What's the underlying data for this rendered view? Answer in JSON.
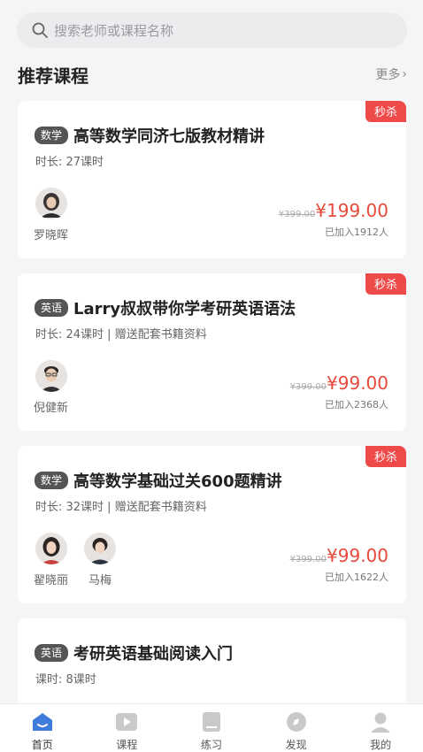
{
  "search": {
    "placeholder": "搜索老师或课程名称"
  },
  "section": {
    "title": "推荐课程",
    "more": "更多"
  },
  "courses": [
    {
      "flash": "秒杀",
      "subject": "数学",
      "title": "高等数学同济七版教材精讲",
      "meta": "时长:  27课时",
      "teachers": [
        "罗晓晖"
      ],
      "original_price": "¥399.00",
      "price": "¥199.00",
      "enrolled": "已加入1912人"
    },
    {
      "flash": "秒杀",
      "subject": "英语",
      "title": "Larry叔叔带你学考研英语语法",
      "meta": "时长:  24课时 | 赠送配套书籍资料",
      "teachers": [
        "倪健新"
      ],
      "original_price": "¥399.00",
      "price": "¥99.00",
      "enrolled": "已加入2368人"
    },
    {
      "flash": "秒杀",
      "subject": "数学",
      "title": "高等数学基础过关600题精讲",
      "meta": "时长:  32课时 | 赠送配套书籍资料",
      "teachers": [
        "翟晓丽",
        "马梅"
      ],
      "original_price": "¥399.00",
      "price": "¥99.00",
      "enrolled": "已加入1622人"
    },
    {
      "subject": "英语",
      "title": "考研英语基础阅读入门",
      "meta": "课时:  8课时"
    }
  ],
  "tabs": [
    {
      "label": "首页",
      "icon": "home-icon",
      "active": true
    },
    {
      "label": "课程",
      "icon": "play-icon"
    },
    {
      "label": "练习",
      "icon": "book-icon"
    },
    {
      "label": "发现",
      "icon": "compass-icon"
    },
    {
      "label": "我的",
      "icon": "user-icon"
    }
  ],
  "colors": {
    "accent": "#e74a3b",
    "flash_bg": "#ef4a4a",
    "tab_active": "#3f7bd8",
    "tab_inactive": "#c9c9cc"
  }
}
